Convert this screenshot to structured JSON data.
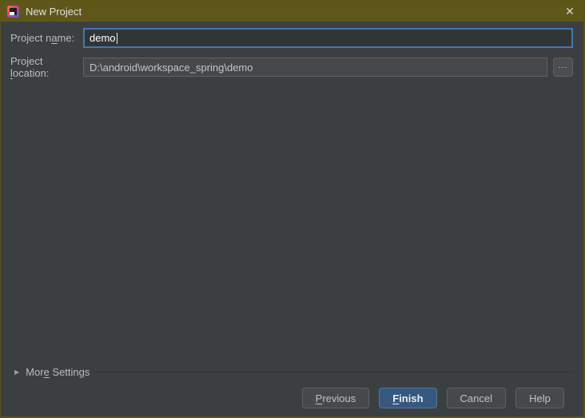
{
  "window": {
    "title": "New Project",
    "close_glyph": "✕"
  },
  "form": {
    "name_label": {
      "pre": "Project n",
      "mnemonic": "a",
      "post": "me:"
    },
    "name_value": "demo",
    "location_label": {
      "pre": "Project ",
      "mnemonic": "l",
      "post": "ocation:"
    },
    "location_value": "D:\\android\\workspace_spring\\demo",
    "browse_label": "..."
  },
  "more_settings": {
    "arrow_glyph": "▶",
    "label": {
      "pre": "Mor",
      "mnemonic": "e",
      "post": " Settings"
    }
  },
  "buttons": {
    "previous": {
      "pre": "",
      "mnemonic": "P",
      "post": "revious"
    },
    "finish": {
      "pre": "",
      "mnemonic": "F",
      "post": "inish"
    },
    "cancel": "Cancel",
    "help": "Help"
  },
  "colors": {
    "titlebar_accent": "#5e5719",
    "focus_border": "#4678a9",
    "primary_button": "#365880",
    "panel_background": "#3c3f41"
  }
}
